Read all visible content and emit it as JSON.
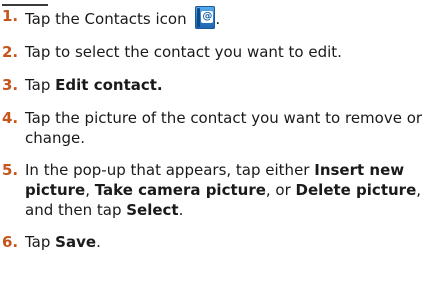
{
  "steps": [
    {
      "num": "1.",
      "parts": [
        {
          "text": "Tap the Contacts icon ",
          "bold": false
        }
      ],
      "icon": "contacts-book-icon",
      "after_icon": "."
    },
    {
      "num": "2.",
      "parts": [
        {
          "text": "Tap to select the contact you want to edit.",
          "bold": false
        }
      ]
    },
    {
      "num": "3.",
      "parts": [
        {
          "text": "Tap ",
          "bold": false
        },
        {
          "text": "Edit contact.",
          "bold": true
        }
      ]
    },
    {
      "num": "4.",
      "parts": [
        {
          "text": "Tap the picture of the contact you want to remove or change.",
          "bold": false
        }
      ]
    },
    {
      "num": "5.",
      "parts": [
        {
          "text": "In the pop-up that appears, tap either ",
          "bold": false
        },
        {
          "text": "Insert new picture",
          "bold": true
        },
        {
          "text": ", ",
          "bold": false
        },
        {
          "text": "Take camera picture",
          "bold": true
        },
        {
          "text": ", or ",
          "bold": false
        },
        {
          "text": "Delete picture",
          "bold": true
        },
        {
          "text": ", and then tap ",
          "bold": false
        },
        {
          "text": "Select",
          "bold": true
        },
        {
          "text": ".",
          "bold": false
        }
      ]
    },
    {
      "num": "6.",
      "parts": [
        {
          "text": "Tap ",
          "bold": false
        },
        {
          "text": "Save",
          "bold": true
        },
        {
          "text": ".",
          "bold": false
        }
      ]
    }
  ],
  "icon_glyph": "@",
  "colors": {
    "step_number": "#c6551c",
    "text": "#1a1a1a",
    "icon_blue": "#2a80cf"
  }
}
